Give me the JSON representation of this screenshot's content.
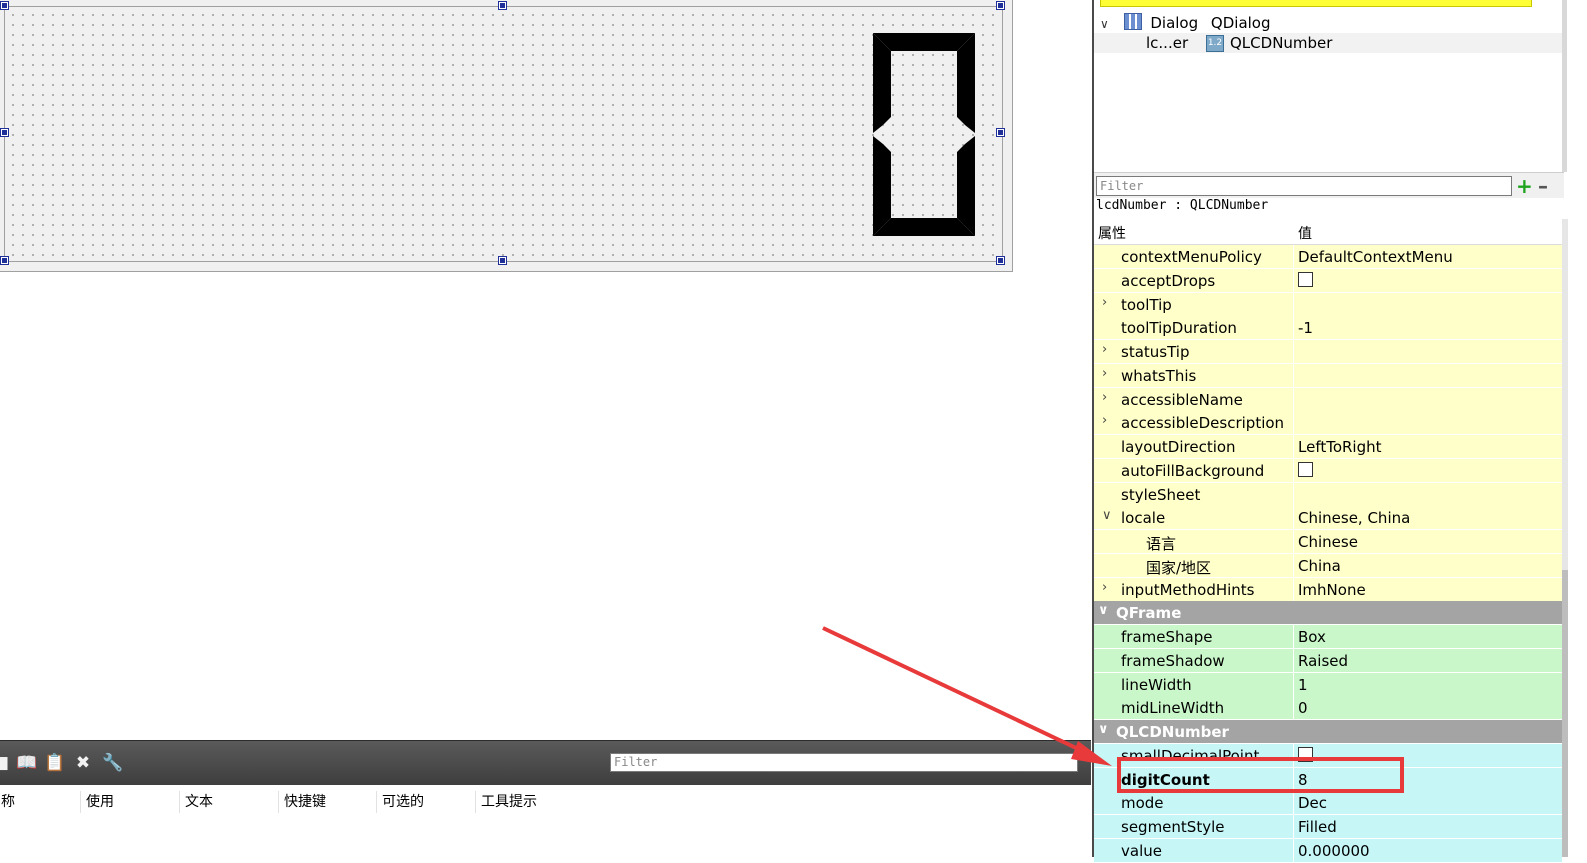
{
  "canvas": {
    "lcd_value": "0"
  },
  "object_inspector": {
    "rows": [
      {
        "name": "Dialog",
        "class": "QDialog",
        "icon": "dialog-icon"
      },
      {
        "name": "lc...er",
        "class": "QLCDNumber",
        "icon": "lcd-number-icon"
      }
    ]
  },
  "property_editor": {
    "filter_placeholder": "Filter",
    "object_label": "lcdNumber : QLCDNumber",
    "header": {
      "property": "属性",
      "value": "值"
    },
    "rows": [
      {
        "name": "contextMenuPolicy",
        "value": "DefaultContextMenu",
        "kind": "y"
      },
      {
        "name": "acceptDrops",
        "value": "",
        "checkbox": true,
        "kind": "y"
      },
      {
        "name": "toolTip",
        "value": "",
        "expandable": true,
        "kind": "y"
      },
      {
        "name": "toolTipDuration",
        "value": "-1",
        "kind": "y"
      },
      {
        "name": "statusTip",
        "value": "",
        "expandable": true,
        "kind": "y"
      },
      {
        "name": "whatsThis",
        "value": "",
        "expandable": true,
        "kind": "y"
      },
      {
        "name": "accessibleName",
        "value": "",
        "expandable": true,
        "kind": "y"
      },
      {
        "name": "accessibleDescription",
        "value": "",
        "expandable": true,
        "kind": "y"
      },
      {
        "name": "layoutDirection",
        "value": "LeftToRight",
        "kind": "y"
      },
      {
        "name": "autoFillBackground",
        "value": "",
        "checkbox": true,
        "kind": "y"
      },
      {
        "name": "styleSheet",
        "value": "",
        "kind": "y"
      },
      {
        "name": "locale",
        "value": "Chinese, China",
        "expanded": true,
        "kind": "y"
      },
      {
        "name": "语言",
        "value": "Chinese",
        "child": true,
        "kind": "y"
      },
      {
        "name": "国家/地区",
        "value": "China",
        "child": true,
        "kind": "y"
      },
      {
        "name": "inputMethodHints",
        "value": "ImhNone",
        "expandable": true,
        "kind": "y"
      },
      {
        "name": "QFrame",
        "value": "",
        "section": true
      },
      {
        "name": "frameShape",
        "value": "Box",
        "kind": "g"
      },
      {
        "name": "frameShadow",
        "value": "Raised",
        "kind": "g"
      },
      {
        "name": "lineWidth",
        "value": "1",
        "kind": "g"
      },
      {
        "name": "midLineWidth",
        "value": "0",
        "kind": "g"
      },
      {
        "name": "QLCDNumber",
        "value": "",
        "section": true
      },
      {
        "name": "smallDecimalPoint",
        "value": "",
        "checkbox": true,
        "kind": "c"
      },
      {
        "name": "digitCount",
        "value": "8",
        "bold": true,
        "kind": "c"
      },
      {
        "name": "mode",
        "value": "Dec",
        "kind": "c"
      },
      {
        "name": "segmentStyle",
        "value": "Filled",
        "kind": "c"
      },
      {
        "name": "value",
        "value": "0.000000",
        "kind": "c"
      }
    ]
  },
  "action_editor": {
    "filter_placeholder": "Filter",
    "toolbar_icons": [
      "new-action-icon",
      "copy-action-icon",
      "paste-action-icon",
      "delete-action-icon",
      "configure-icon"
    ],
    "columns": [
      "称",
      "使用",
      "文本",
      "快捷键",
      "可选的",
      "工具提示"
    ]
  },
  "colors": {
    "highlight": "#e83a3a",
    "section": "#a4a4a4",
    "qwidget_row": "#ffffc9",
    "qframe_row": "#caf7ca",
    "qlcd_row": "#c6f6f6"
  }
}
